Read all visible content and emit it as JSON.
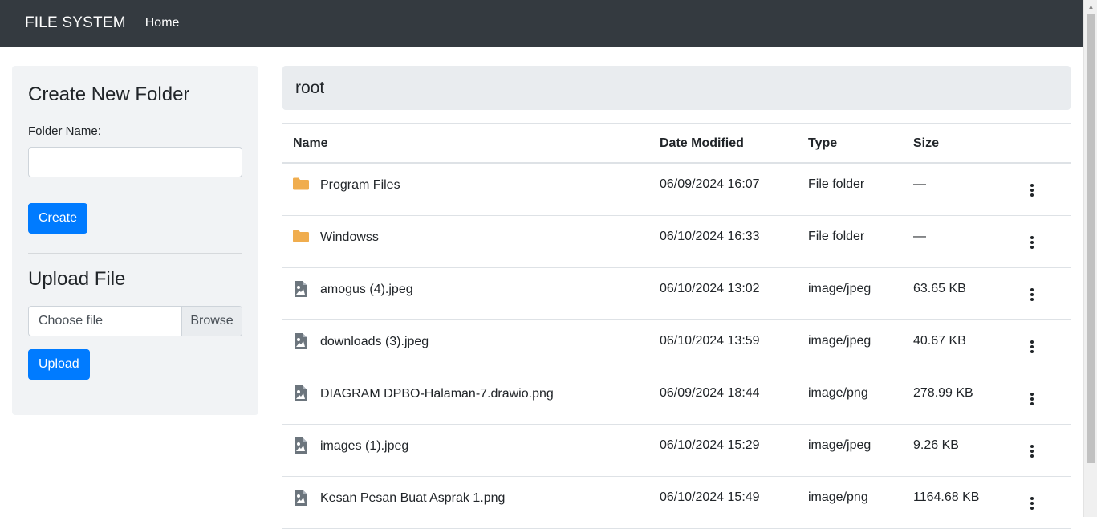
{
  "navbar": {
    "brand": "FILE SYSTEM",
    "home": "Home"
  },
  "sidebar": {
    "create_title": "Create New Folder",
    "folder_label": "Folder Name:",
    "folder_value": "",
    "create_button": "Create",
    "upload_title": "Upload File",
    "file_placeholder": "Choose file",
    "browse_label": "Browse",
    "upload_button": "Upload"
  },
  "breadcrumb": {
    "current": "root"
  },
  "table": {
    "headers": {
      "name": "Name",
      "date": "Date Modified",
      "type": "Type",
      "size": "Size"
    },
    "rows": [
      {
        "icon": "folder-icon",
        "name": "Program Files",
        "date": "06/09/2024 16:07",
        "type": "File folder",
        "size": "—"
      },
      {
        "icon": "folder-icon",
        "name": "Windowss",
        "date": "06/10/2024 16:33",
        "type": "File folder",
        "size": "—"
      },
      {
        "icon": "image-file-icon",
        "name": "amogus (4).jpeg",
        "date": "06/10/2024 13:02",
        "type": "image/jpeg",
        "size": "63.65 KB"
      },
      {
        "icon": "image-file-icon",
        "name": "downloads (3).jpeg",
        "date": "06/10/2024 13:59",
        "type": "image/jpeg",
        "size": "40.67 KB"
      },
      {
        "icon": "image-file-icon",
        "name": "DIAGRAM DPBO-Halaman-7.drawio.png",
        "date": "06/09/2024 18:44",
        "type": "image/png",
        "size": "278.99 KB"
      },
      {
        "icon": "image-file-icon",
        "name": "images (1).jpeg",
        "date": "06/10/2024 15:29",
        "type": "image/jpeg",
        "size": "9.26 KB"
      },
      {
        "icon": "image-file-icon",
        "name": "Kesan Pesan Buat Asprak 1.png",
        "date": "06/10/2024 15:49",
        "type": "image/png",
        "size": "1164.68 KB"
      }
    ]
  },
  "colors": {
    "navbar": "#343a40",
    "primary": "#007bff",
    "folder": "#f0ad4e",
    "file_icon": "#6c757d"
  }
}
